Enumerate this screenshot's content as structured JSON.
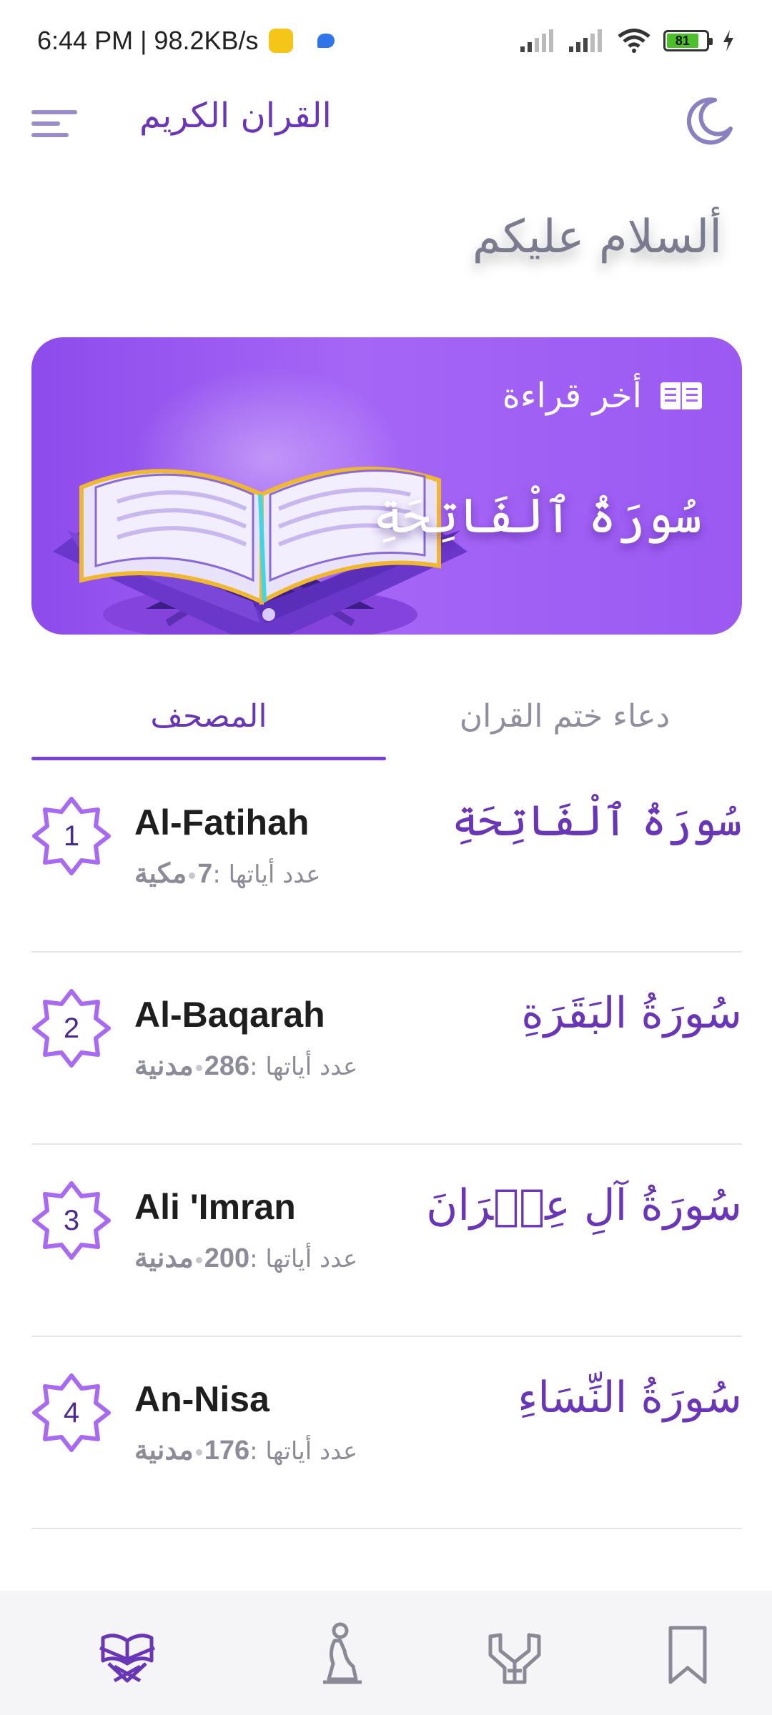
{
  "status_bar": {
    "time_speed": "6:44 PM | 98.2KB/s",
    "battery": "81"
  },
  "app_bar": {
    "title": "القران الكريم",
    "icons": [
      "menu-icon",
      "moon-icon"
    ]
  },
  "greeting": "ألسلام عليكم",
  "last_read": {
    "label": "أخر قراءة",
    "surah": "سُورَةُ ٱلْفَاتِحَةِ"
  },
  "tabs": [
    {
      "label": "المصحف",
      "active": true
    },
    {
      "label": "دعاء ختم القران",
      "active": false
    }
  ],
  "surahs": [
    {
      "number": "1",
      "name_en": "Al-Fatihah",
      "ayah_label": "عدد أياتها :",
      "ayah_count": "7",
      "type": "مكية",
      "name_ar": "سُورَةُ ٱلْفَاتِحَةِ"
    },
    {
      "number": "2",
      "name_en": "Al-Baqarah",
      "ayah_label": "عدد أياتها :",
      "ayah_count": "286",
      "type": "مدنية",
      "name_ar": "سُورَةُ البَقَرَةِ"
    },
    {
      "number": "3",
      "name_en": "Ali 'Imran",
      "ayah_label": "عدد أياتها :",
      "ayah_count": "200",
      "type": "مدنية",
      "name_ar": "سُورَةُ آلِ عِمۡرَانَ"
    },
    {
      "number": "4",
      "name_en": "An-Nisa",
      "ayah_label": "عدد أياتها :",
      "ayah_count": "176",
      "type": "مدنية",
      "name_ar": "سُورَةُ النِّسَاءِ"
    }
  ],
  "bottom_nav": [
    "quran-book-icon",
    "prayer-icon",
    "dua-hands-icon",
    "bookmark-icon"
  ],
  "colors": {
    "accent": "#6a36b8",
    "card": "#9b59f2",
    "active_nav": "#7a42d6",
    "muted": "#8c8c99"
  }
}
